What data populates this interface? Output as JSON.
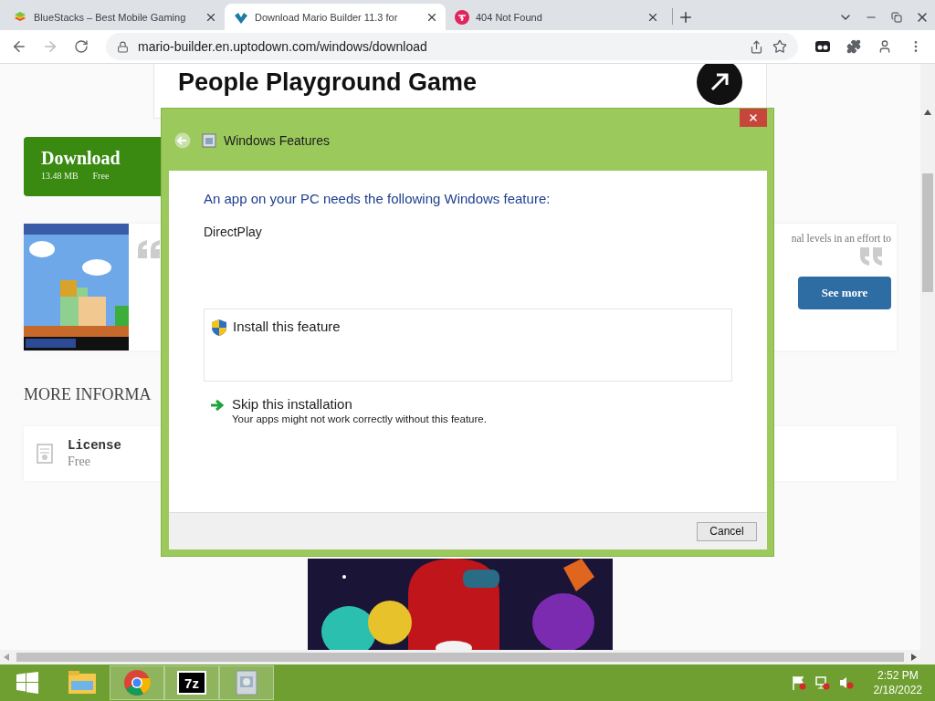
{
  "browser": {
    "tabs": [
      {
        "title": "BlueStacks – Best Mobile Gaming",
        "kind": "bluestacks",
        "selected": false
      },
      {
        "title": "Download Mario Builder 11.3 for",
        "kind": "uptodown",
        "selected": true
      },
      {
        "title": "404 Not Found",
        "kind": "hindi",
        "selected": false
      }
    ],
    "address": "mario-builder.en.uptodown.com/windows/download"
  },
  "page": {
    "ad_heading": "People Playground Game",
    "download": {
      "label": "Download",
      "size": "13.48 MB",
      "price": "Free"
    },
    "review": {
      "excerpt": "nal levels in an effort to",
      "button": "See more"
    },
    "section_heading": "MORE INFORMA",
    "license": {
      "label": "License",
      "value": "Free"
    }
  },
  "dialog": {
    "title": "Windows Features",
    "heading": "An app on your PC needs the following Windows feature:",
    "feature": "DirectPlay",
    "options": [
      {
        "kind": "install",
        "label": "Install this feature"
      },
      {
        "kind": "skip",
        "label": "Skip this installation",
        "note": "Your apps might not work correctly without this feature."
      }
    ],
    "buttons": [
      "Cancel"
    ]
  },
  "taskbar": {
    "apps": [
      {
        "kind": "explorer",
        "active": false
      },
      {
        "kind": "chrome",
        "active": true
      },
      {
        "kind": "sevenzip",
        "label": "7z",
        "active": true
      },
      {
        "kind": "features",
        "active": true
      }
    ],
    "time": "2:52 PM",
    "date": "2/18/2022"
  }
}
